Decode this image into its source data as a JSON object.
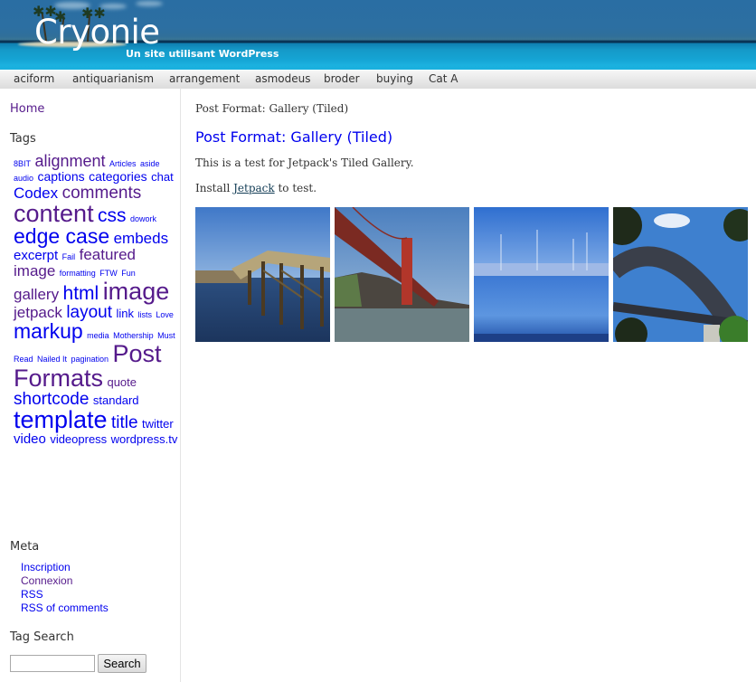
{
  "header": {
    "site_title": "Cryonie",
    "site_description": "Un site utilisant WordPress"
  },
  "nav": {
    "items": [
      "aciform",
      "antiquarianism",
      "arrangement",
      "asmodeus",
      "broder",
      "buying",
      "Cat A"
    ]
  },
  "sidebar": {
    "home_label": "Home",
    "tags_heading": "Tags",
    "tags": [
      {
        "label": "8BIT",
        "size": 8,
        "visited": false
      },
      {
        "label": "alignment",
        "size": 15,
        "visited": true
      },
      {
        "label": "Articles",
        "size": 8,
        "visited": false
      },
      {
        "label": "aside",
        "size": 8,
        "visited": false
      },
      {
        "label": "audio",
        "size": 8,
        "visited": false
      },
      {
        "label": "captions",
        "size": 12,
        "visited": false
      },
      {
        "label": "categories",
        "size": 12,
        "visited": false
      },
      {
        "label": "chat",
        "size": 11,
        "visited": false
      },
      {
        "label": "Codex",
        "size": 14,
        "visited": false
      },
      {
        "label": "comments",
        "size": 16,
        "visited": true
      },
      {
        "label": "content",
        "size": 22,
        "visited": true
      },
      {
        "label": "css",
        "size": 17,
        "visited": false
      },
      {
        "label": "dowork",
        "size": 8,
        "visited": false
      },
      {
        "label": "edge case",
        "size": 19,
        "visited": false
      },
      {
        "label": "embeds",
        "size": 14,
        "visited": false
      },
      {
        "label": "excerpt",
        "size": 13,
        "visited": false
      },
      {
        "label": "Fail",
        "size": 8,
        "visited": false
      },
      {
        "label": "featured image",
        "size": 14,
        "visited": true
      },
      {
        "label": "formatting",
        "size": 8,
        "visited": false
      },
      {
        "label": "FTW",
        "size": 8,
        "visited": false
      },
      {
        "label": "Fun",
        "size": 8,
        "visited": false
      },
      {
        "label": "gallery",
        "size": 14,
        "visited": true
      },
      {
        "label": "html",
        "size": 17,
        "visited": false
      },
      {
        "label": "image",
        "size": 22,
        "visited": true
      },
      {
        "label": "jetpack",
        "size": 14,
        "visited": true
      },
      {
        "label": "layout",
        "size": 16,
        "visited": false
      },
      {
        "label": "link",
        "size": 11,
        "visited": false
      },
      {
        "label": "lists",
        "size": 8,
        "visited": false
      },
      {
        "label": "Love",
        "size": 8,
        "visited": false
      },
      {
        "label": "markup",
        "size": 19,
        "visited": false
      },
      {
        "label": "media",
        "size": 8,
        "visited": false
      },
      {
        "label": "Mothership",
        "size": 8,
        "visited": false
      },
      {
        "label": "Must Read",
        "size": 8,
        "visited": false
      },
      {
        "label": "Nailed It",
        "size": 8,
        "visited": false
      },
      {
        "label": "pagination",
        "size": 8,
        "visited": false
      },
      {
        "label": "Post Formats",
        "size": 22,
        "visited": true
      },
      {
        "label": "quote",
        "size": 11,
        "visited": true
      },
      {
        "label": "shortcode",
        "size": 16,
        "visited": false
      },
      {
        "label": "standard",
        "size": 11,
        "visited": false
      },
      {
        "label": "template",
        "size": 22,
        "visited": false
      },
      {
        "label": "title",
        "size": 16,
        "visited": false
      },
      {
        "label": "twitter",
        "size": 11,
        "visited": false
      },
      {
        "label": "video",
        "size": 13,
        "visited": false
      },
      {
        "label": "videopress",
        "size": 11,
        "visited": false
      },
      {
        "label": "wordpress.tv",
        "size": 11,
        "visited": false
      }
    ],
    "meta_heading": "Meta",
    "meta_links": [
      {
        "label": "Inscription",
        "visited": false
      },
      {
        "label": "Connexion",
        "visited": true
      },
      {
        "label": "RSS",
        "visited": false
      },
      {
        "label": "RSS of comments",
        "visited": false
      }
    ],
    "tag_search_heading": "Tag Search",
    "search_value": "",
    "search_button": "Search"
  },
  "main": {
    "breadcrumb": "Post Format: Gallery (Tiled)",
    "post_title": "Post Format: Gallery (Tiled)",
    "paragraph1": "This is a test for Jetpack's Tiled Gallery.",
    "paragraph2_before": "Install ",
    "paragraph2_link": "Jetpack",
    "paragraph2_after": " to test.",
    "gallery": [
      {
        "subject": "wooden pier over water"
      },
      {
        "subject": "Golden Gate Bridge from below"
      },
      {
        "subject": "marina with boats in blue light"
      },
      {
        "subject": "Sydney Harbour Bridge arch"
      }
    ]
  },
  "colors": {
    "link": "#0000ee",
    "visited": "#551a8b",
    "nav_text": "#333333",
    "body_text": "#333333"
  }
}
